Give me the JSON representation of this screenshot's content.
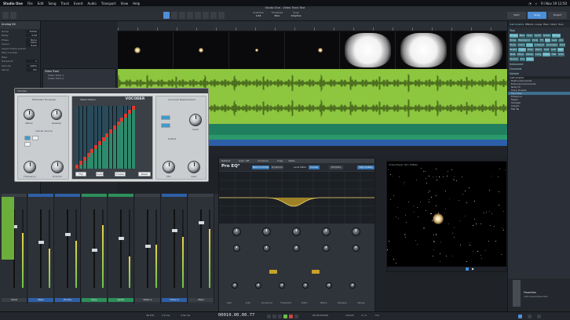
{
  "macbar": {
    "app": "Studio One",
    "menus": [
      "File",
      "Edit",
      "Song",
      "Track",
      "Event",
      "Audio",
      "Transport",
      "View",
      "Help"
    ],
    "right": [
      "Fri Nov 19 12:50"
    ]
  },
  "window": {
    "title": "Studio One - Video Track Test"
  },
  "toolbar": {
    "labels": [
      "Quantize",
      "Timebase",
      "Snap"
    ],
    "values": [
      "1/16",
      "Bars",
      "Adaptive"
    ],
    "right_buttons": [
      "Start",
      "Song",
      "Project"
    ]
  },
  "inspector": {
    "title": "Analog Kit",
    "rows": [
      {
        "label": "Group",
        "value": "Follow"
      },
      {
        "label": "Delay",
        "value": "0.00"
      },
      {
        "label": "Phase",
        "value": "None"
      },
      {
        "label": "Layers",
        "value": "Video Track"
      },
      {
        "label": "Layers follow events",
        "value": ""
      },
      {
        "label": "Play overlaps",
        "value": ""
      },
      {
        "label": "Filter",
        "value": ""
      },
      {
        "label": "Transform",
        "value": "1"
      },
      {
        "label": "Velocity",
        "value": "100%"
      },
      {
        "label": "Swing",
        "value": "0%"
      }
    ]
  },
  "tracks": {
    "header": "Video Track",
    "items": [
      "Video Track 1",
      "Video Track 2"
    ]
  },
  "browser": {
    "tabs": [
      "Instruments",
      "Effects",
      "Loops",
      "Files",
      "Cloud",
      "Pool"
    ],
    "section_tags": "Tags",
    "tags": [
      "Drums",
      "Bass",
      "Keys",
      "Synth",
      "Guitar",
      "Strings",
      "Brass",
      "Woodwind",
      "Vocal",
      "FX",
      "Pad",
      "Lead",
      "Arp",
      "Pluck",
      "Chord",
      "Loop",
      "Ambient",
      "Cinematic",
      "Dark",
      "Bright",
      "Clean",
      "Dirty",
      "Warm",
      "Cold",
      "Soft",
      "Hard",
      "Wide",
      "Mono",
      "Stereo",
      "Long",
      "Short",
      "Fast",
      "Slow",
      "Punchy",
      "Airy",
      "Deep"
    ],
    "section_instrument": "Instrument",
    "section_character": "Character",
    "section_sample": "Sample",
    "tree_header": "Instruments",
    "tree": [
      "Multi Instruments",
      "External Instruments",
      "Note FX",
      "Track Presets",
      "Favorites",
      "Presence",
      "Mojito",
      "Sampler",
      "Impact",
      "Mai Tai"
    ],
    "footer_title": "Favorites",
    "footer_sub": "Instruments/Favorites"
  },
  "vocoder": {
    "title": "Vocoder",
    "tabs": [
      "Modulator Envelope",
      "Match Matrix",
      "Unvoiced Replacement"
    ],
    "knobs": [
      "Attack",
      "Release",
      "Frequency",
      "Q-factor",
      "Level",
      "Attn"
    ],
    "carrier_labels": [
      "Carrier Source",
      "Output"
    ],
    "buttons": [
      "Flip",
      "Invert",
      "Freeze",
      "Reset"
    ],
    "output_knobs": [
      "Mix",
      "Gain"
    ],
    "brand": "VOCODER"
  },
  "proeq": {
    "title": "Pro EQ³",
    "header_fields": [
      "Default",
      "Auto: Off",
      "Compare",
      "Copy",
      "Paste"
    ],
    "band_buttons": [
      "Band Controls",
      "Dynamics",
      "Level Meter",
      "Curves",
      "Mid/Side",
      "High Quality"
    ],
    "knob_labels": [
      "Freq",
      "Gain",
      "Q",
      "Freq",
      "Gain",
      "Q",
      "Freq",
      "Gain",
      "Q",
      "Freq",
      "Gain",
      "Q"
    ],
    "bottom_labels": [
      "Gain",
      "Auto",
      "Dynamics",
      "Threshold",
      "Ratio",
      "Attack",
      "Release",
      "Range"
    ]
  },
  "video": {
    "title": "Video Player (Pro 1080p)"
  },
  "mixer": {
    "strips": [
      "Vocal",
      "Bass",
      "Drums",
      "Keys",
      "Synth",
      "Video 1",
      "Video 2",
      "Main"
    ],
    "bottom_labels": [
      "Master",
      "Audio In"
    ]
  },
  "transport": {
    "labels": [
      "48 kHz",
      "2.0 ms",
      "3.92 ms",
      "Record Max",
      "Performance",
      "Timecode",
      "Loop",
      "Tempo",
      "Time Sig",
      "Metronome",
      "Key"
    ],
    "time": "00010.00.00.77",
    "position": "00:00:00.000",
    "tempo": "120.00",
    "signature": "4 / 4",
    "key": "Cm"
  },
  "colors": {
    "accent": "#4d8fd6",
    "audio_green": "#8dc63f",
    "track_teal": "#2a8d6c",
    "track_blue": "#2c5fa8",
    "vocoder_panel": "#d9dcde"
  }
}
